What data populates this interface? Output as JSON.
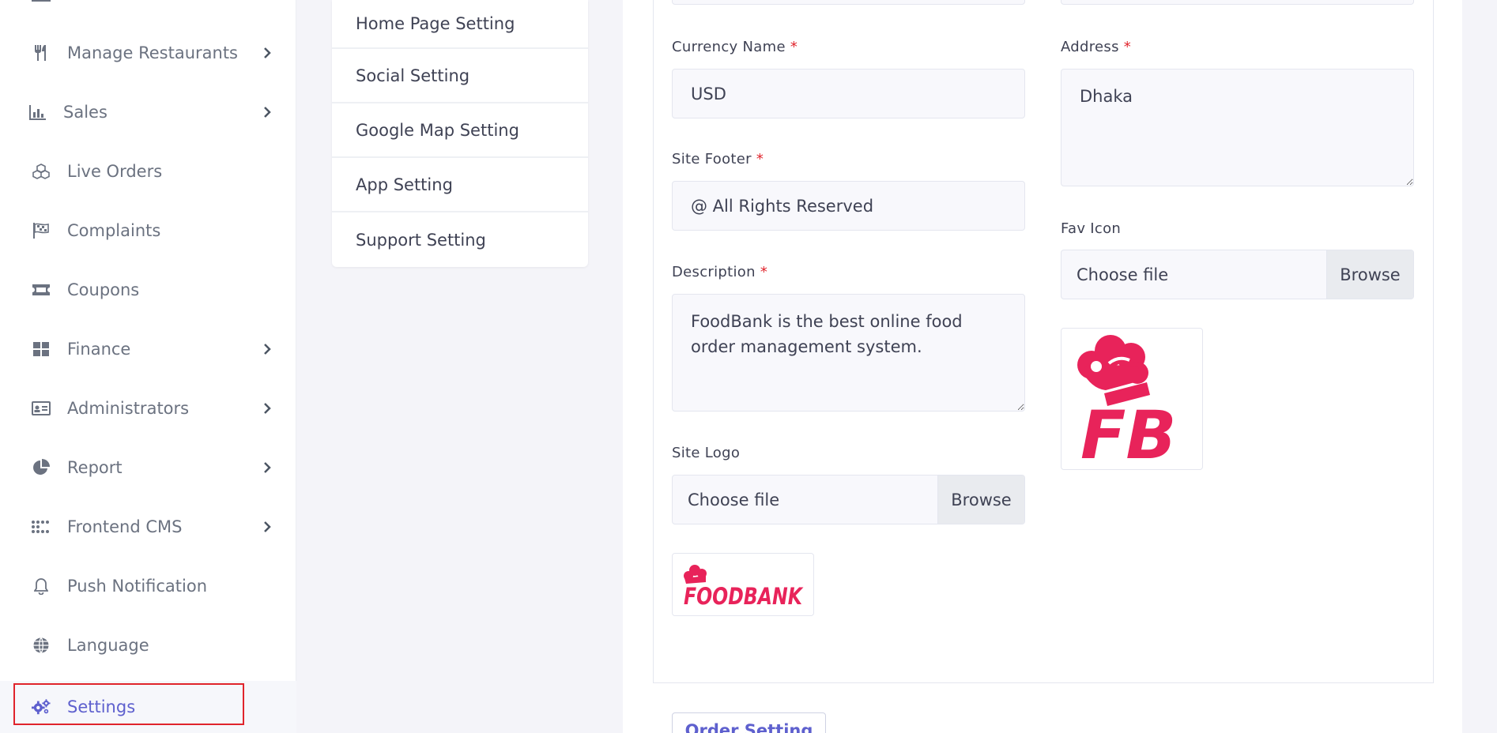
{
  "sidebar": {
    "items": [
      {
        "label": "Manage Restaurants",
        "icon": "utensils-icon",
        "chevron": true
      },
      {
        "label": "Sales",
        "icon": "bar-chart-icon",
        "chevron": true
      },
      {
        "label": "Live Orders",
        "icon": "cubes-icon",
        "chevron": false
      },
      {
        "label": "Complaints",
        "icon": "flag-checkered-icon",
        "chevron": false
      },
      {
        "label": "Coupons",
        "icon": "ticket-icon",
        "chevron": false
      },
      {
        "label": "Finance",
        "icon": "grid-icon",
        "chevron": true
      },
      {
        "label": "Administrators",
        "icon": "id-card-icon",
        "chevron": true
      },
      {
        "label": "Report",
        "icon": "pie-chart-icon",
        "chevron": true
      },
      {
        "label": "Frontend CMS",
        "icon": "dots-grid-icon",
        "chevron": true
      },
      {
        "label": "Push Notification",
        "icon": "bell-icon",
        "chevron": false
      },
      {
        "label": "Language",
        "icon": "globe-icon",
        "chevron": false
      },
      {
        "label": "Settings",
        "icon": "gears-icon",
        "chevron": false,
        "active": true
      }
    ]
  },
  "submenu": {
    "items": [
      "Home Page Setting",
      "Social Setting",
      "Google Map Setting",
      "App Setting",
      "Support Setting"
    ]
  },
  "form": {
    "currency_name": {
      "label": "Currency Name",
      "value": "USD"
    },
    "address": {
      "label": "Address",
      "value": "Dhaka"
    },
    "site_footer": {
      "label": "Site Footer",
      "value": "@ All Rights Reserved"
    },
    "description": {
      "label": "Description",
      "value": "FoodBank is the best online food order management system."
    },
    "site_logo": {
      "label": "Site Logo",
      "file_text": "Choose file",
      "browse": "Browse"
    },
    "fav_icon": {
      "label": "Fav Icon",
      "file_text": "Choose file",
      "browse": "Browse"
    },
    "required_mark": "*"
  },
  "logos": {
    "site_logo_text": "FOODBANK",
    "fav_icon_text": "FB",
    "brand_color": "#e8235a"
  },
  "footer_button": {
    "label": "Order Setting"
  },
  "colors": {
    "accent": "#5e60ce",
    "highlight": "#e0242c",
    "required": "#e0242c"
  }
}
